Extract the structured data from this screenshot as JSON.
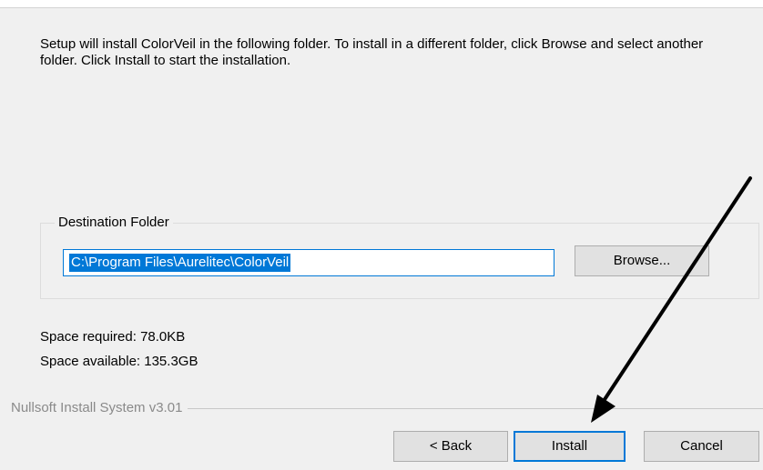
{
  "intro_text": "Setup will install ColorVeil in the following folder. To install in a different folder, click Browse and select another folder. Click Install to start the installation.",
  "destination": {
    "legend": "Destination Folder",
    "path": "C:\\Program Files\\Aurelitec\\ColorVeil",
    "browse_label": "Browse..."
  },
  "space": {
    "required": "Space required: 78.0KB",
    "available": "Space available: 135.3GB"
  },
  "branding": "Nullsoft Install System v3.01",
  "buttons": {
    "back": "< Back",
    "install": "Install",
    "cancel": "Cancel"
  },
  "colors": {
    "accent": "#0078d7",
    "annotation_arrow": "#000000"
  },
  "icons": {
    "annotation": "arrow-pointer-icon"
  }
}
